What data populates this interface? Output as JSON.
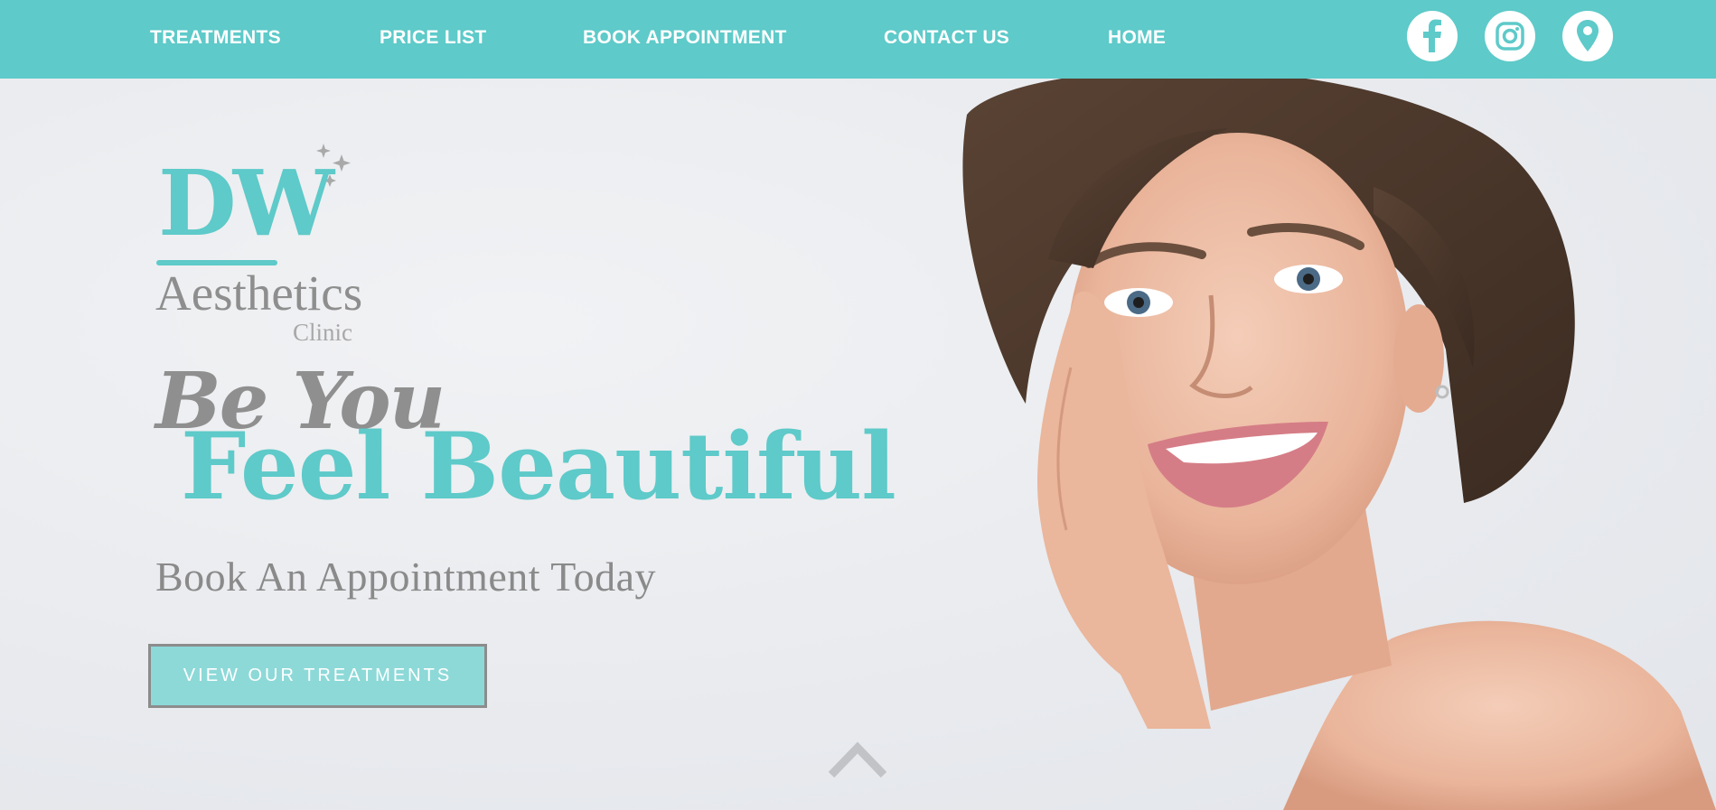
{
  "nav": {
    "items": [
      {
        "label": "TREATMENTS"
      },
      {
        "label": "PRICE LIST"
      },
      {
        "label": "BOOK APPOINTMENT"
      },
      {
        "label": "CONTACT US"
      },
      {
        "label": "HOME"
      }
    ],
    "social_icons": [
      "facebook-icon",
      "instagram-icon",
      "location-pin-icon"
    ],
    "background_color": "#5ecac9"
  },
  "logo": {
    "initials": "DW",
    "name": "Aesthetics",
    "subname": "Clinic"
  },
  "hero": {
    "tagline_line1": "Be You",
    "tagline_line2": "Feel Beautiful",
    "subheading": "Book An Appointment Today",
    "cta_label": "VIEW OUR TREATMENTS",
    "scroll_icon": "chevron-up-icon"
  },
  "colors": {
    "accent": "#5ecac9",
    "accent_light": "#8dd9d8",
    "text_gray": "#8f8f8f",
    "background": "#eceef1"
  }
}
